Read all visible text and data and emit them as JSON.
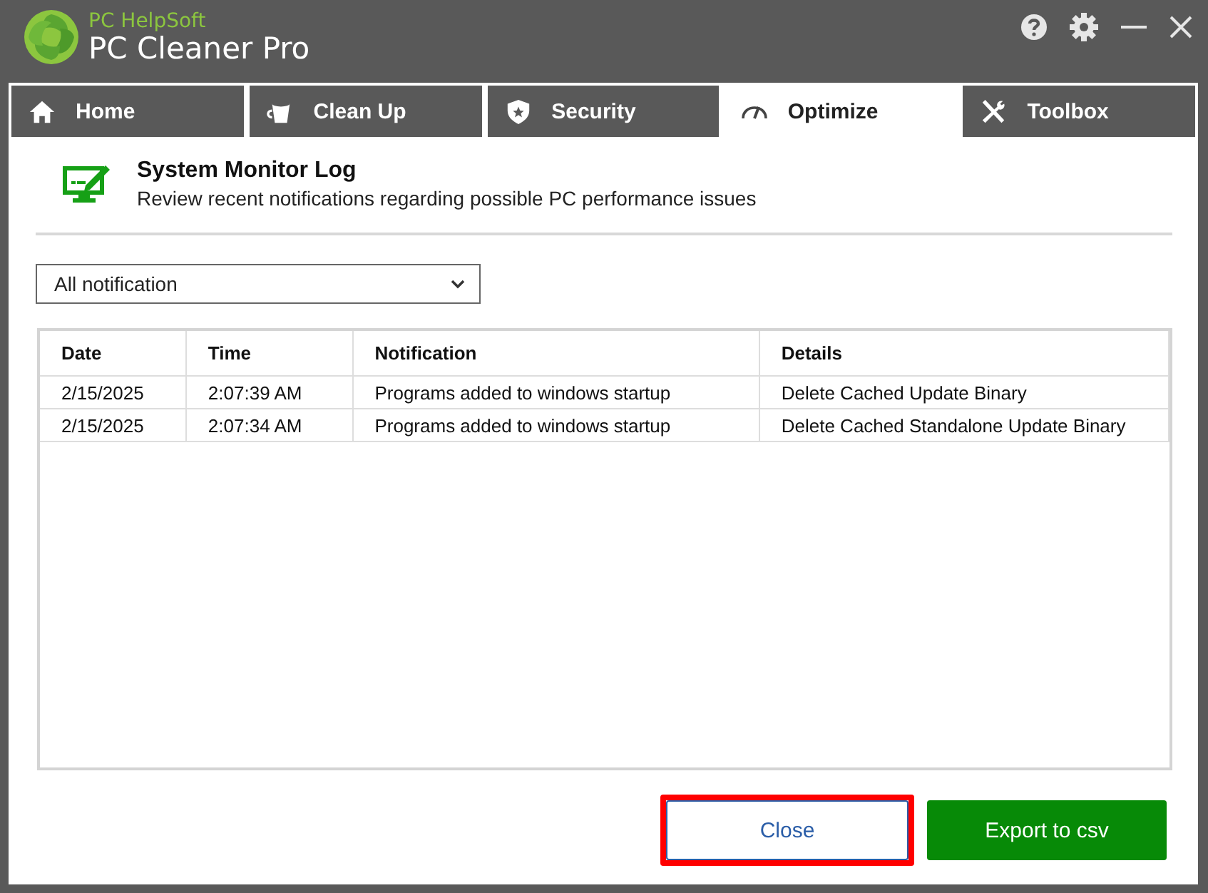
{
  "app": {
    "brand": "PC HelpSoft",
    "title": "PC Cleaner Pro"
  },
  "tabs": [
    {
      "label": "Home",
      "selected": false
    },
    {
      "label": "Clean Up",
      "selected": false
    },
    {
      "label": "Security",
      "selected": false
    },
    {
      "label": "Optimize",
      "selected": true
    },
    {
      "label": "Toolbox",
      "selected": false
    }
  ],
  "header": {
    "title": "System Monitor Log",
    "subtitle": "Review recent notifications regarding possible PC performance issues"
  },
  "filter": {
    "value": "All notification"
  },
  "table": {
    "columns": [
      "Date",
      "Time",
      "Notification",
      "Details"
    ],
    "rows": [
      [
        "2/15/2025",
        "2:07:39 AM",
        "Programs added to windows startup",
        "Delete Cached Update Binary"
      ],
      [
        "2/15/2025",
        "2:07:34 AM",
        "Programs added to windows startup",
        "Delete Cached Standalone Update Binary"
      ]
    ]
  },
  "buttons": [
    {
      "label": "Close",
      "kind": "outline",
      "highlighted": true
    },
    {
      "label": "Export to csv",
      "kind": "primary",
      "highlighted": false
    }
  ]
}
